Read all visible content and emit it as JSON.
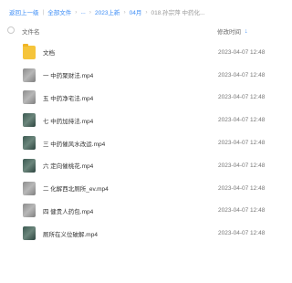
{
  "breadcrumb": {
    "back": "返回上一级",
    "all_files": "全部文件",
    "ellipsis": "...",
    "folder1": "2023上新",
    "folder2": "04月",
    "current": "018.孙宗萍 中药化..."
  },
  "header": {
    "name_col": "文件名",
    "date_col": "修改时间",
    "sort_icon": "arrow-down-icon"
  },
  "files": [
    {
      "name": "文档",
      "date": "2023-04-07 12:48",
      "type": "folder"
    },
    {
      "name": "一 中药聚财法.mp4",
      "date": "2023-04-07 12:48",
      "type": "video-gray"
    },
    {
      "name": "五 中药净宅法.mp4",
      "date": "2023-04-07 12:48",
      "type": "video-gray"
    },
    {
      "name": "七 中药加持法.mp4",
      "date": "2023-04-07 12:48",
      "type": "video-green"
    },
    {
      "name": "三 中药催风水改运.mp4",
      "date": "2023-04-07 12:48",
      "type": "video-green"
    },
    {
      "name": "六 定向催桃花.mp4",
      "date": "2023-04-07 12:48",
      "type": "video-green"
    },
    {
      "name": "二 化解西北厕所_ev.mp4",
      "date": "2023-04-07 12:48",
      "type": "video-gray"
    },
    {
      "name": "四 健贵人药包.mp4",
      "date": "2023-04-07 12:48",
      "type": "video-gray"
    },
    {
      "name": "厕所在义位破解.mp4",
      "date": "2023-04-07 12:48",
      "type": "video-green"
    }
  ]
}
